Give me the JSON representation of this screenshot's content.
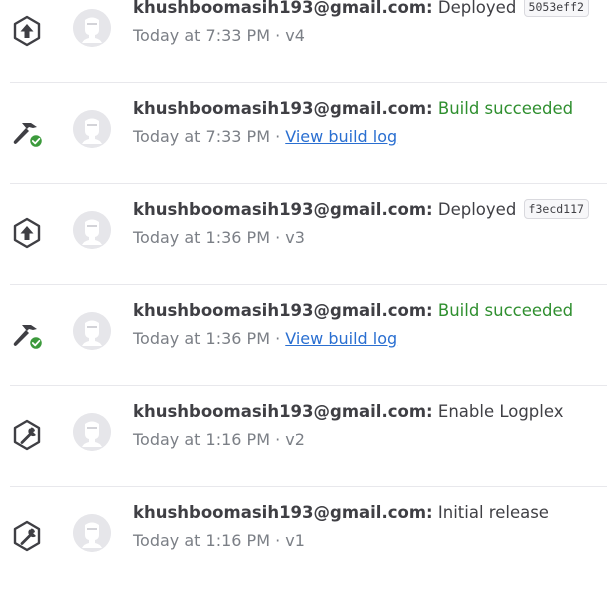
{
  "activity": [
    {
      "type": "deploy",
      "user": "khushboomasih193@gmail.com:",
      "message": "Deployed",
      "sha": "5053eff2",
      "time": "Today at 7:33 PM",
      "sep": " · ",
      "version": "v4"
    },
    {
      "type": "build",
      "user": "khushboomasih193@gmail.com:",
      "message": "Build succeeded",
      "time": "Today at 7:33 PM",
      "sep": " · ",
      "link": "View build log"
    },
    {
      "type": "deploy",
      "user": "khushboomasih193@gmail.com:",
      "message": "Deployed",
      "sha": "f3ecd117",
      "time": "Today at 1:36 PM",
      "sep": " · ",
      "version": "v3"
    },
    {
      "type": "build",
      "user": "khushboomasih193@gmail.com:",
      "message": "Build succeeded",
      "time": "Today at 1:36 PM",
      "sep": " · ",
      "link": "View build log"
    },
    {
      "type": "config",
      "user": "khushboomasih193@gmail.com:",
      "message": "Enable Logplex",
      "time": "Today at 1:16 PM",
      "sep": " · ",
      "version": "v2"
    },
    {
      "type": "config",
      "user": "khushboomasih193@gmail.com:",
      "message": "Initial release",
      "time": "Today at 1:16 PM",
      "sep": " · ",
      "version": "v1"
    }
  ],
  "icons": {
    "deploy": "deploy-arrow-icon",
    "build": "build-hammer-success-icon",
    "config": "wrench-icon",
    "avatar": "default-avatar-icon"
  },
  "colors": {
    "success": "#2f8f2f",
    "link": "#2a6fd1",
    "text": "#3f3f44",
    "muted": "#7b7f86"
  }
}
